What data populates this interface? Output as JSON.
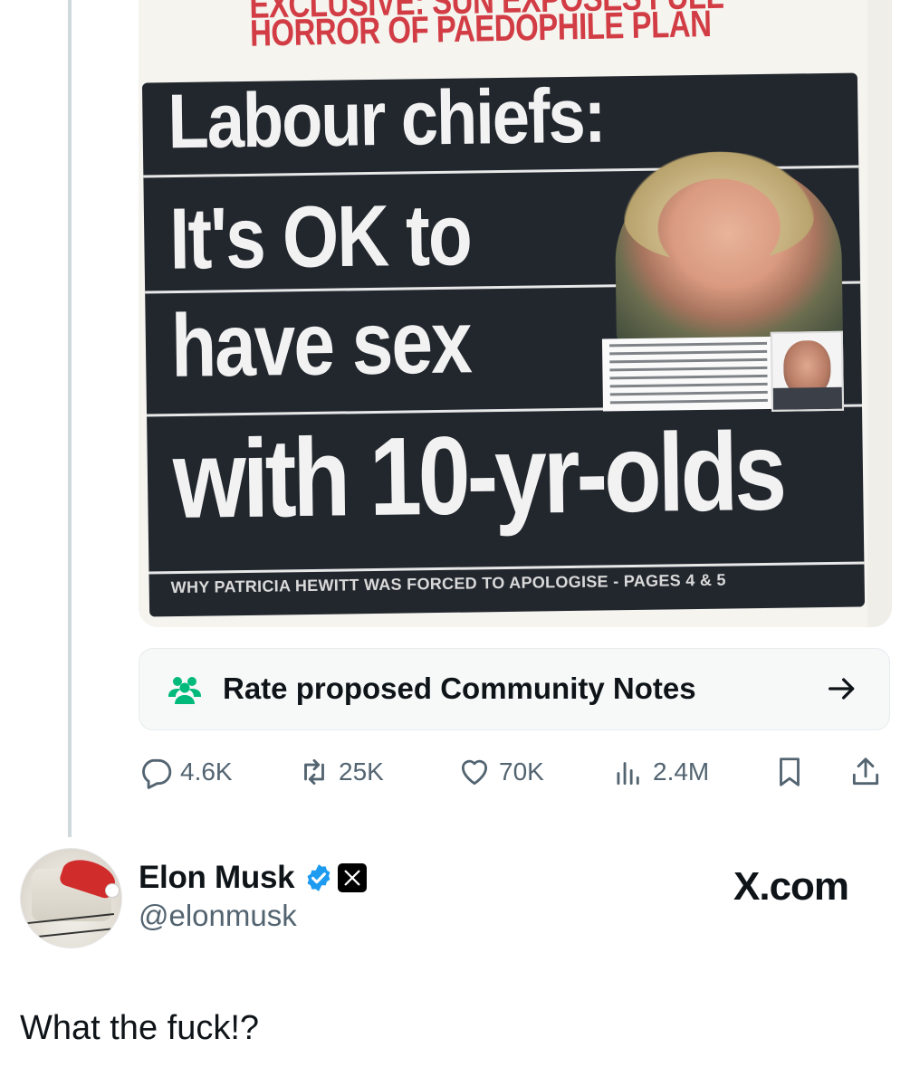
{
  "media": {
    "kicker_line1": "EXCLUSIVE: SUN EXPOSES FULL",
    "kicker_line2": "HORROR OF PAEDOPHILE PLAN",
    "headline_line1": "Labour chiefs:",
    "headline_line2": "It's OK to",
    "headline_line3": "have sex",
    "headline_line4": "with 10-yr-olds",
    "footer": "WHY PATRICIA HEWITT WAS FORCED TO APOLOGISE - PAGES 4 & 5"
  },
  "community_notes": {
    "label": "Rate proposed Community Notes",
    "icon": "people-icon",
    "arrow_icon": "arrow-right-icon",
    "icon_color": "#00ba7c"
  },
  "actions": {
    "replies": "4.6K",
    "reposts": "25K",
    "likes": "70K",
    "views": "2.4M"
  },
  "reply": {
    "name": "Elon Musk",
    "handle": "@elonmusk",
    "source": "X.com",
    "text": "What the fuck!?",
    "verified_color": "#1d9bf0"
  }
}
